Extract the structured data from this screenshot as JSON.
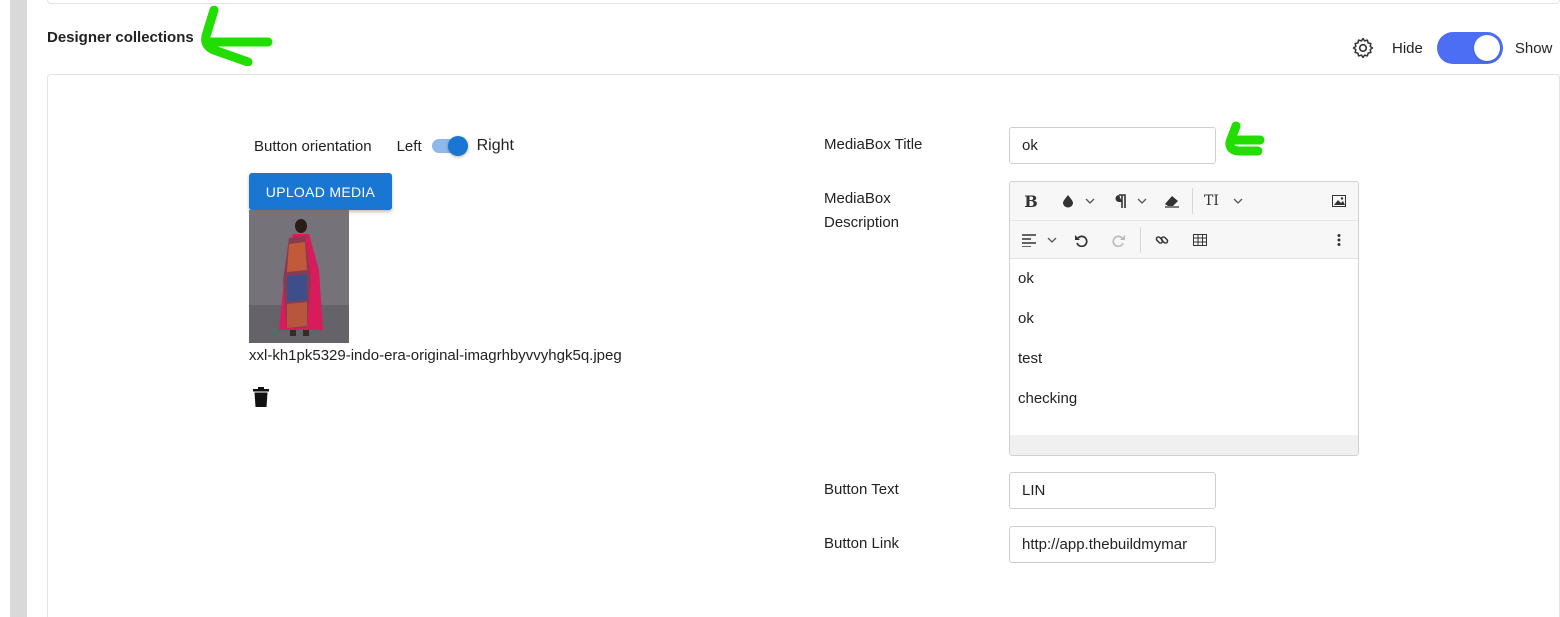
{
  "section": {
    "title": "Designer collections",
    "hide_label": "Hide",
    "show_label": "Show",
    "visible": true
  },
  "media": {
    "orientation_label": "Button orientation",
    "orientation_left": "Left",
    "orientation_right": "Right",
    "orientation_selected": "Right",
    "upload_label": "UPLOAD MEDIA",
    "file_name": "xxl-kh1pk5329-indo-era-original-imagrhbyvvyhgk5q.jpeg"
  },
  "form": {
    "title_label": "MediaBox Title",
    "title_value": "ok",
    "description_label_line1": "MediaBox",
    "description_label_line2": "Description",
    "description_paragraphs": [
      "ok",
      "ok",
      "test",
      "checking"
    ],
    "button_text_label": "Button Text",
    "button_text_value": "LIN",
    "button_link_label": "Button Link",
    "button_link_value": "http://app.thebuildmymar"
  },
  "editor_toolbar": {
    "row1": [
      "bold-icon",
      "text-color-icon",
      "paragraph-icon",
      "eraser-icon",
      "font-size-icon",
      "image-icon"
    ],
    "row2": [
      "align-icon",
      "undo-icon",
      "redo-icon",
      "link-icon",
      "table-icon",
      "more-icon"
    ],
    "bold_glyph": "B",
    "font_size_glyph": "TI"
  },
  "colors": {
    "accent": "#1976d2",
    "toggle": "#4c6ef5",
    "annotation": "#22dd00"
  }
}
